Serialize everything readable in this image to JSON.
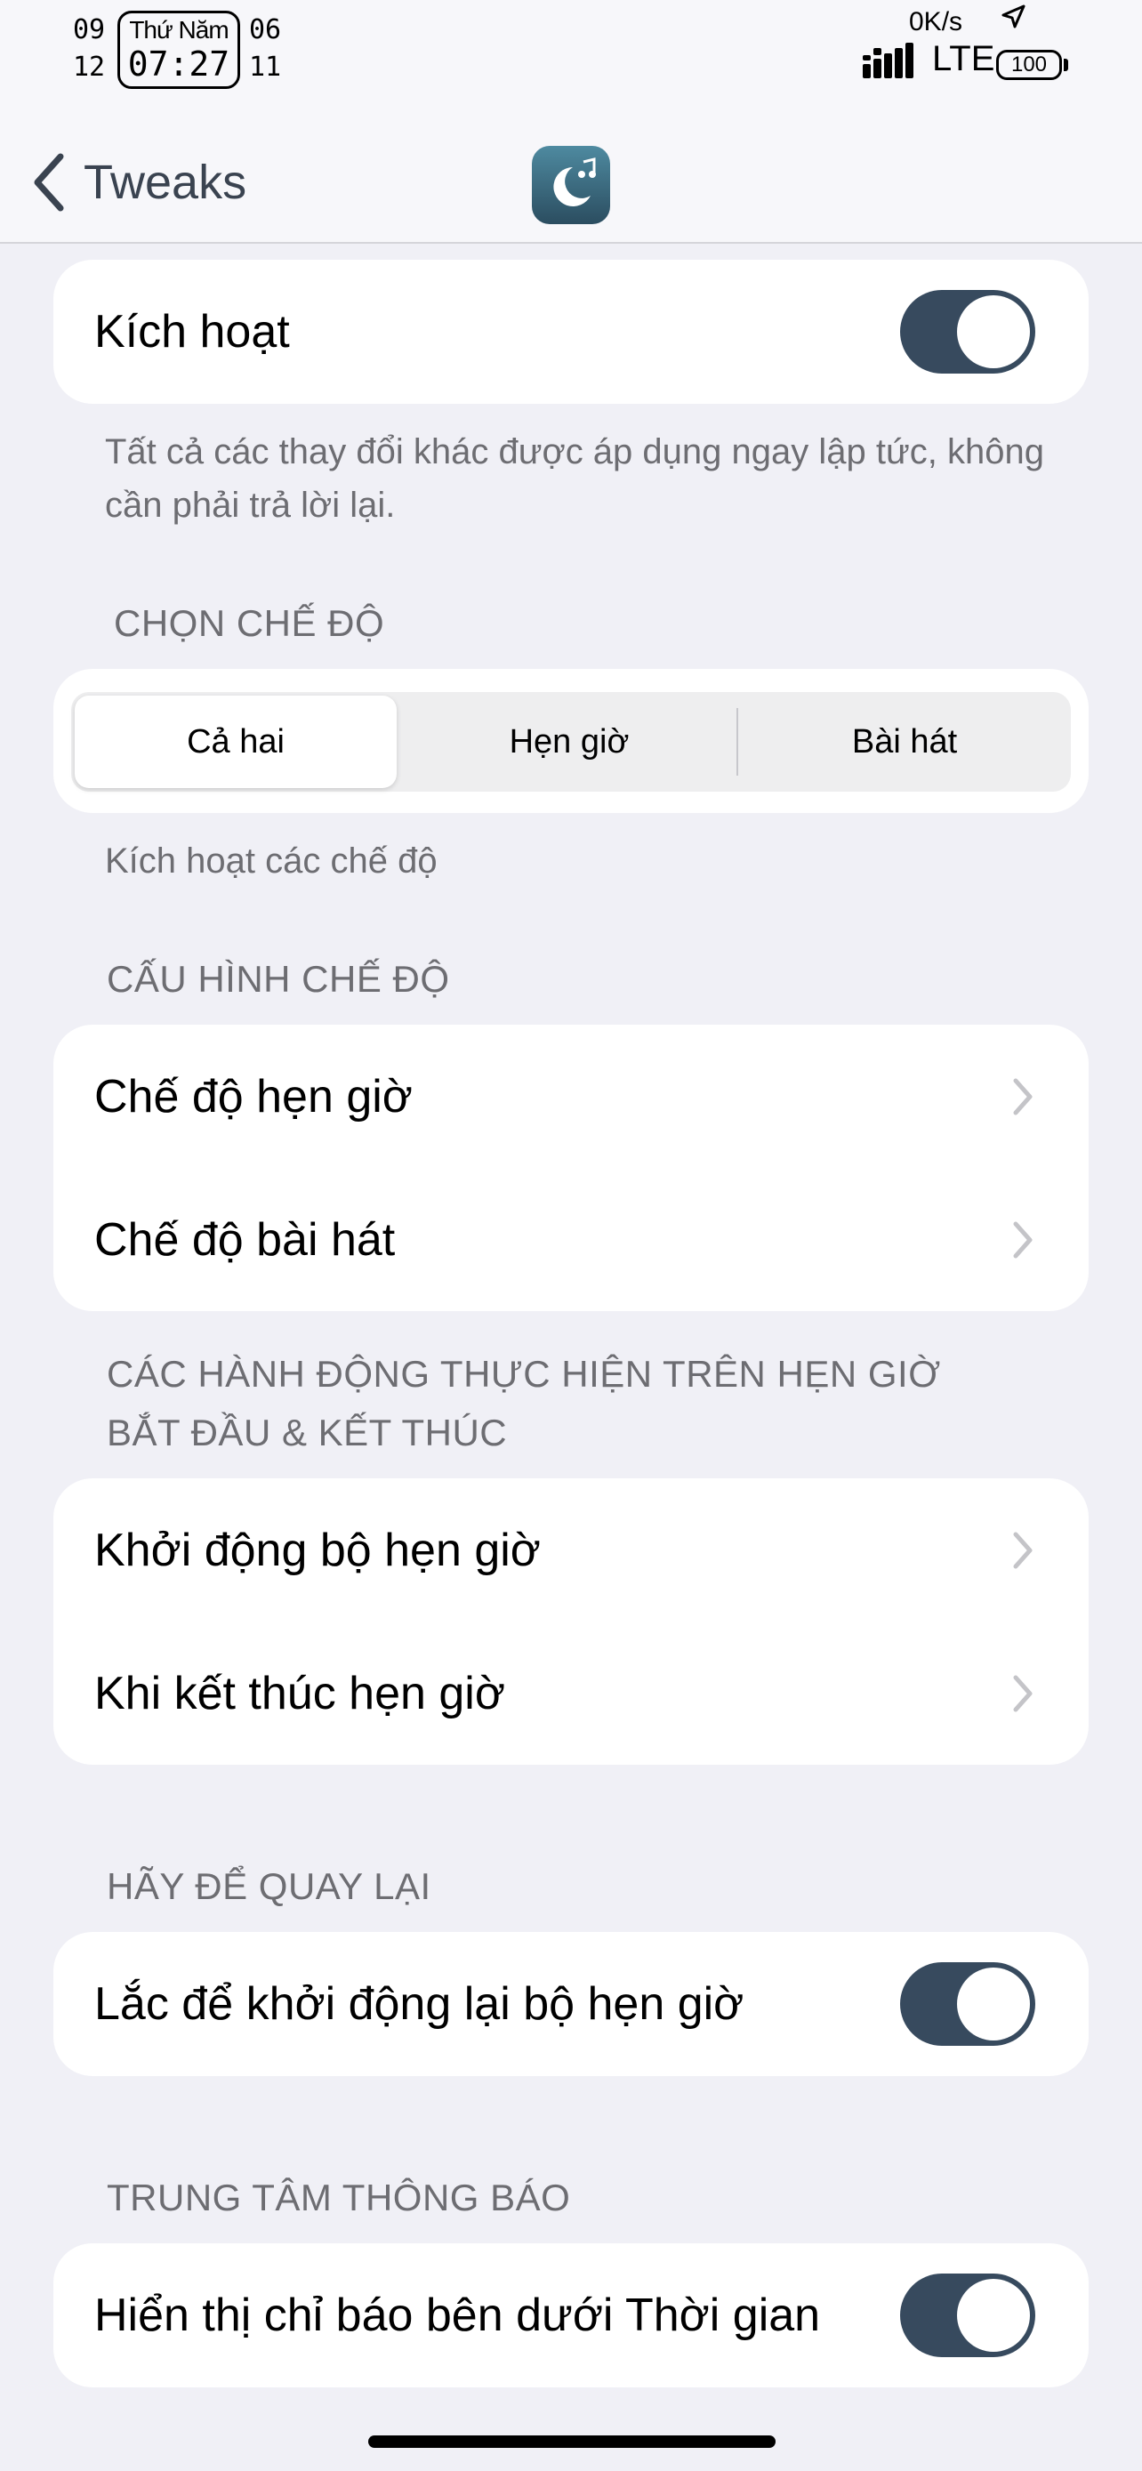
{
  "status_bar": {
    "left_top": "09",
    "left_bottom": "12",
    "right_top": "06",
    "right_bottom": "11",
    "day": "Thứ Năm",
    "time": "07:27",
    "net_speed": "0K/s",
    "location_icon": "location-arrow-icon",
    "carrier": "LTE",
    "battery": "100"
  },
  "nav": {
    "back_label": "Tweaks",
    "app_icon": "moon-music-icon"
  },
  "enable": {
    "label": "Kích hoạt",
    "on": true,
    "footer": "Tất cả các thay đổi khác được áp dụng ngay lập tức, không cần phải trả lời lại."
  },
  "mode": {
    "header": "CHỌN CHẾ ĐỘ",
    "options": [
      "Cả hai",
      "Hẹn giờ",
      "Bài hát"
    ],
    "selected": "Cả hai",
    "footer": "Kích hoạt các chế độ"
  },
  "config": {
    "header": "CẤU HÌNH CHẾ ĐỘ",
    "items": [
      "Chế độ hẹn giờ",
      "Chế độ bài hát"
    ]
  },
  "actions": {
    "header": "CÁC HÀNH ĐỘNG THỰC HIỆN TRÊN HẸN GIỜ BẮT ĐẦU & KẾT THÚC",
    "items": [
      "Khởi động bộ hẹn giờ",
      "Khi kết thúc hẹn giờ"
    ]
  },
  "shake": {
    "header": "HÃY ĐỂ QUAY LẠI",
    "label": "Lắc để khởi động lại bộ hẹn giờ",
    "on": true
  },
  "notification_center": {
    "header": "TRUNG TÂM THÔNG BÁO",
    "label": "Hiển thị chỉ báo bên dưới Thời gian",
    "on": true
  },
  "colors": {
    "toggle_on": "#374a5e",
    "background": "#f0f0f6"
  }
}
